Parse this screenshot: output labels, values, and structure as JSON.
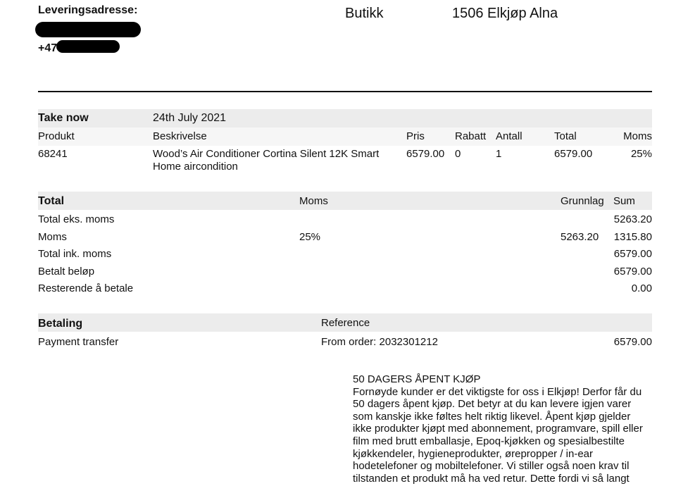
{
  "header": {
    "delivery_label": "Leveringsadresse:",
    "phone_prefix": "+47",
    "store_label": "Butikk",
    "store_value": "1506 Elkjøp Alna"
  },
  "order": {
    "section_title": "Take now",
    "date": "24th July 2021",
    "columns": [
      "Produkt",
      "Beskrivelse",
      "Pris",
      "Rabatt",
      "Antall",
      "Total",
      "Moms"
    ],
    "row": {
      "product": "68241",
      "description_line1": "Wood’s Air Conditioner Cortina Silent 12K Smart",
      "description_line2": "Home aircondition",
      "price": "6579.00",
      "discount": "0",
      "quantity": "1",
      "total": "6579.00",
      "vat": "25%"
    }
  },
  "totals": {
    "section_title": "Total",
    "col_moms": "Moms",
    "col_grunnlag": "Grunnlag",
    "col_sum": "Sum",
    "rows": [
      {
        "label": "Total eks. moms",
        "moms": "",
        "grunnlag": "",
        "sum": "5263.20"
      },
      {
        "label": "Moms",
        "moms": "25%",
        "grunnlag": "5263.20",
        "sum": "1315.80"
      },
      {
        "label": "Total ink. moms",
        "moms": "",
        "grunnlag": "",
        "sum": "6579.00"
      },
      {
        "label": "Betalt beløp",
        "moms": "",
        "grunnlag": "",
        "sum": "6579.00"
      },
      {
        "label": "Resterende å betale",
        "moms": "",
        "grunnlag": "",
        "sum": "0.00"
      }
    ]
  },
  "payment": {
    "section_title": "Betaling",
    "col_reference": "Reference",
    "method": "Payment transfer",
    "reference": "From order: 2032301212",
    "amount": "6579.00"
  },
  "terms": {
    "title": "50 DAGERS ÅPENT KJØP",
    "body": "Fornøyde kunder er det viktigste for oss i Elkjøp! Derfor får du 50 dagers åpent kjøp. Det betyr at du kan levere igjen varer som kanskje ikke føltes helt riktig likevel. Åpent kjøp gjelder ikke produkter kjøpt med abonnement, programvare, spill eller film med brutt emballasje, Epoq-kjøkken og spesialbestilte kjøkkendeler, hygieneprodukter, ørepropper / in-ear hodetelefoner og mobiltelefoner. Vi stiller også noen krav til tilstanden et produkt må ha ved retur. Dette fordi vi så langt"
  }
}
